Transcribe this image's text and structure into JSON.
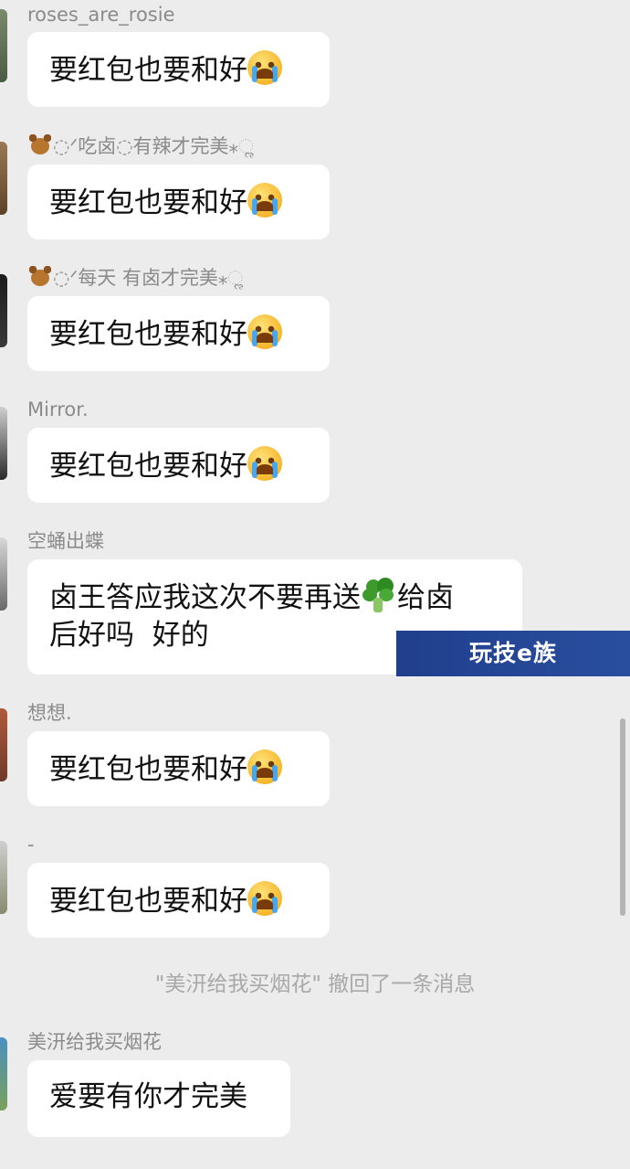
{
  "messages": [
    {
      "name": "roses_are_rosie",
      "text": "要红包也要和好"
    },
    {
      "name": "◌ᐟ吃卤◌有辣才完美⁎ૢ",
      "text": "要红包也要和好"
    },
    {
      "name": "◌ᐟ每天 有卤才完美⁎ૢ",
      "text": "要红包也要和好"
    },
    {
      "name": "Mirror.",
      "text": "要红包也要和好"
    },
    {
      "name": "空蛹出蝶",
      "text_line1": "卤王答应我这次不要再送",
      "text_line1b": "给卤",
      "text_line2": "后好吗  好的"
    },
    {
      "name": "想想.",
      "text": "要红包也要和好"
    },
    {
      "name": "-",
      "text": "要红包也要和好"
    },
    {
      "name": "美汧给我买烟花",
      "text": "爱要有你才完美"
    }
  ],
  "recall_notice": "\"美汧给我买烟花\" 撤回了一条消息",
  "watermark": "玩技e族",
  "icons": {
    "cry": "loudly-crying-face-icon",
    "broccoli": "broccoli-icon",
    "bear": "teddy-bear-icon"
  },
  "colors": {
    "background": "#ececec",
    "bubble": "#ffffff",
    "watermark_bg": "#1f3f8c"
  }
}
